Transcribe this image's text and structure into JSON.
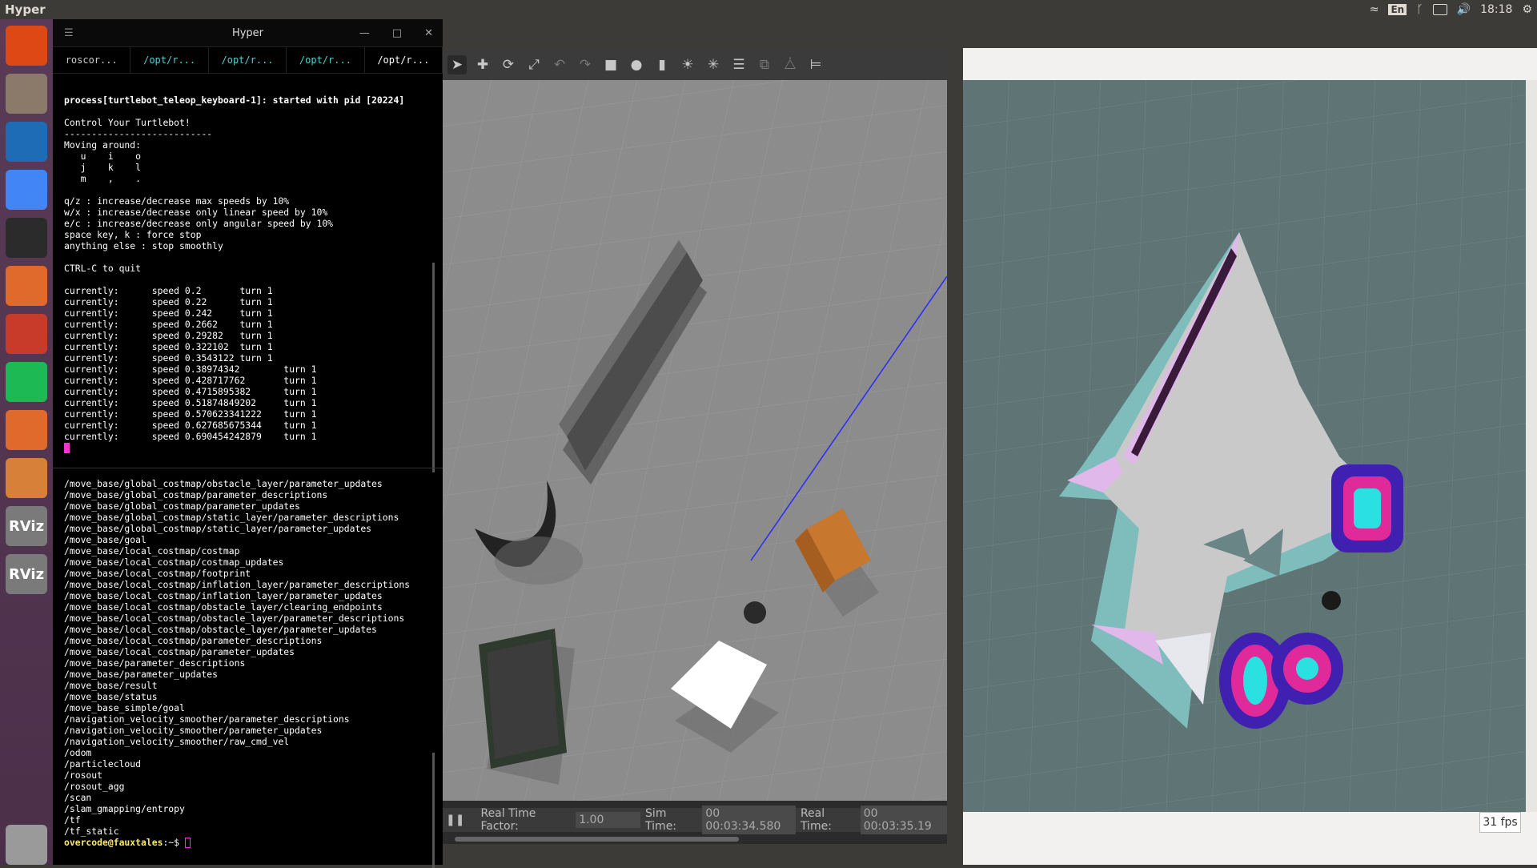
{
  "topbar": {
    "app_name": "Hyper",
    "language": "En",
    "time": "18:18"
  },
  "launcher": {
    "items": [
      {
        "name": "ubuntu-logo-icon",
        "color": "#dd4814"
      },
      {
        "name": "files-icon",
        "color": "#8b7a69"
      },
      {
        "name": "vscode-icon",
        "color": "#1e6cb5"
      },
      {
        "name": "chrome-icon",
        "color": "#4285f4"
      },
      {
        "name": "terminal-icon",
        "color": "#2b2b2b"
      },
      {
        "name": "software-center-icon",
        "color": "#e06a2c"
      },
      {
        "name": "settings-icon",
        "color": "#c83a2a"
      },
      {
        "name": "spotify-icon",
        "color": "#1db954"
      },
      {
        "name": "software-updater-icon",
        "color": "#e06a2c"
      },
      {
        "name": "sublime-icon",
        "color": "#d6803a"
      },
      {
        "name": "rviz-icon",
        "color": "#7a7a7a",
        "label": "RViz"
      },
      {
        "name": "rviz-icon",
        "color": "#7a7a7a",
        "label": "RViz"
      },
      {
        "name": "trash-icon",
        "color": "#9a9a9a"
      }
    ]
  },
  "terminal": {
    "title": "Hyper",
    "tabs": [
      "roscor...",
      "/opt/r...",
      "/opt/r...",
      "/opt/r...",
      "/opt/r..."
    ],
    "pane1": [
      "process[turtlebot_teleop_keyboard-1]: started with pid [20224]",
      "",
      "Control Your Turtlebot!",
      "---------------------------",
      "Moving around:",
      "   u    i    o",
      "   j    k    l",
      "   m    ,    .",
      "",
      "q/z : increase/decrease max speeds by 10%",
      "w/x : increase/decrease only linear speed by 10%",
      "e/c : increase/decrease only angular speed by 10%",
      "space key, k : force stop",
      "anything else : stop smoothly",
      "",
      "CTRL-C to quit",
      "",
      "currently:      speed 0.2       turn 1",
      "currently:      speed 0.22      turn 1",
      "currently:      speed 0.242     turn 1",
      "currently:      speed 0.2662    turn 1",
      "currently:      speed 0.29282   turn 1",
      "currently:      speed 0.322102  turn 1",
      "currently:      speed 0.3543122 turn 1",
      "currently:      speed 0.38974342        turn 1",
      "currently:      speed 0.428717762       turn 1",
      "currently:      speed 0.4715895382      turn 1",
      "currently:      speed 0.51874849202     turn 1",
      "currently:      speed 0.570623341222    turn 1",
      "currently:      speed 0.627685675344    turn 1",
      "currently:      speed 0.690454242879    turn 1"
    ],
    "pane2": [
      "/move_base/global_costmap/obstacle_layer/parameter_updates",
      "/move_base/global_costmap/parameter_descriptions",
      "/move_base/global_costmap/parameter_updates",
      "/move_base/global_costmap/static_layer/parameter_descriptions",
      "/move_base/global_costmap/static_layer/parameter_updates",
      "/move_base/goal",
      "/move_base/local_costmap/costmap",
      "/move_base/local_costmap/costmap_updates",
      "/move_base/local_costmap/footprint",
      "/move_base/local_costmap/inflation_layer/parameter_descriptions",
      "/move_base/local_costmap/inflation_layer/parameter_updates",
      "/move_base/local_costmap/obstacle_layer/clearing_endpoints",
      "/move_base/local_costmap/obstacle_layer/parameter_descriptions",
      "/move_base/local_costmap/obstacle_layer/parameter_updates",
      "/move_base/local_costmap/parameter_descriptions",
      "/move_base/local_costmap/parameter_updates",
      "/move_base/parameter_descriptions",
      "/move_base/parameter_updates",
      "/move_base/result",
      "/move_base/status",
      "/move_base_simple/goal",
      "/navigation_velocity_smoother/parameter_descriptions",
      "/navigation_velocity_smoother/parameter_updates",
      "/navigation_velocity_smoother/raw_cmd_vel",
      "/odom",
      "/particlecloud",
      "/rosout",
      "/rosout_agg",
      "/scan",
      "/slam_gmapping/entropy",
      "/tf",
      "/tf_static"
    ],
    "prompt_user": "overcode@fauxtales",
    "prompt_suffix": ":~$ "
  },
  "gazebo": {
    "status": {
      "rtf_label": "Real Time Factor:",
      "rtf_value": "1.00",
      "sim_label": "Sim Time:",
      "sim_value": "00 00:03:34.580",
      "real_label": "Real Time:",
      "real_value": "00 00:03:35.19"
    }
  },
  "rviz": {
    "fps": "31 fps"
  }
}
